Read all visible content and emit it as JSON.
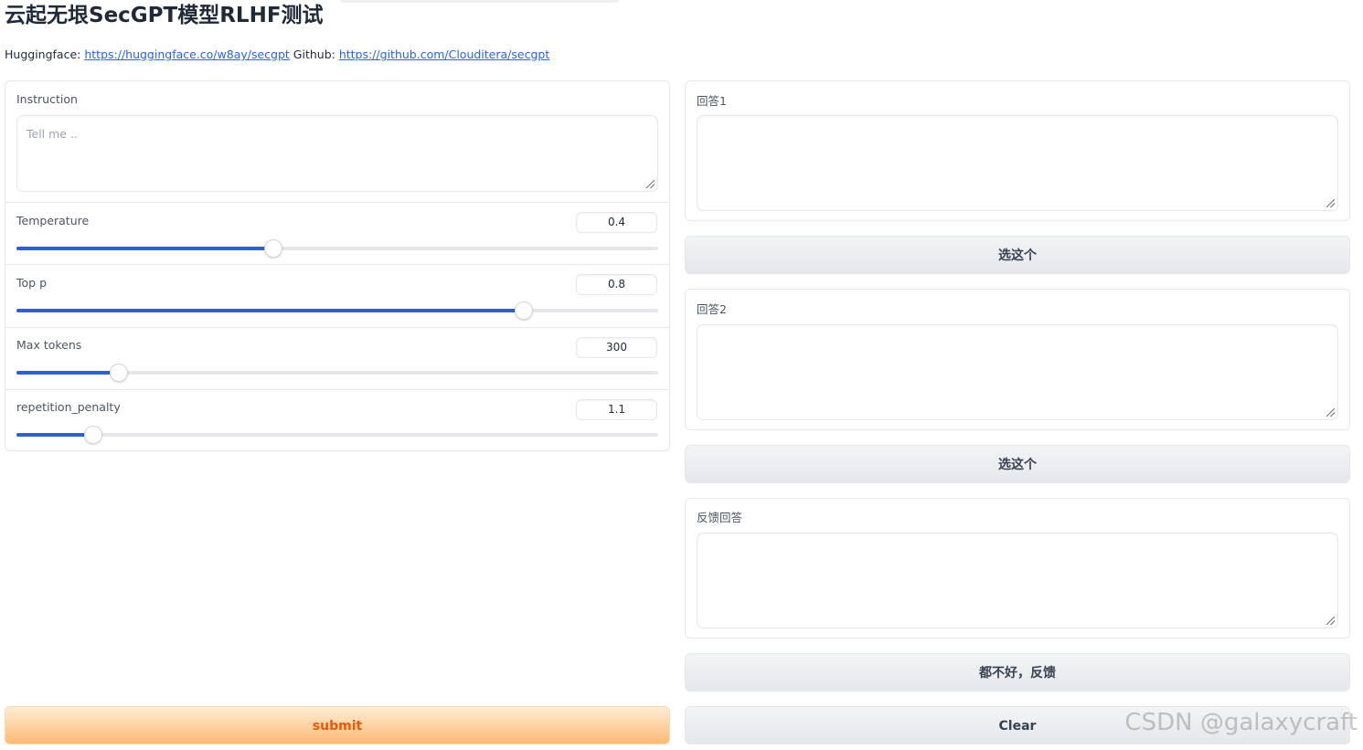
{
  "page": {
    "title": "云起无垠SecGPT模型RLHF测试",
    "links_prefix_1": "Huggingface: ",
    "link_1": "https://huggingface.co/w8ay/secgpt",
    "links_prefix_2": " Github: ",
    "link_2": "https://github.com/Clouditera/secgpt"
  },
  "settings": {
    "instruction": {
      "label": "Instruction",
      "placeholder": "Tell me ..",
      "value": ""
    },
    "temperature": {
      "label": "Temperature",
      "value": "0.4",
      "fraction": 0.4
    },
    "top_p": {
      "label": "Top p",
      "value": "0.8",
      "fraction": 0.79
    },
    "max_tokens": {
      "label": "Max tokens",
      "value": "300",
      "fraction": 0.16
    },
    "repetition_penalty": {
      "label": "repetition_penalty",
      "value": "1.1",
      "fraction": 0.12
    }
  },
  "answers": {
    "answer1_label": "回答1",
    "answer2_label": "回答2",
    "feedback_label": "反馈回答",
    "choose_label": "选这个",
    "none_good_label": "都不好，反馈"
  },
  "buttons": {
    "submit_label": "submit",
    "clear_label": "Clear"
  },
  "watermark": "CSDN @galaxycraft",
  "colors": {
    "slider_fill": "#2f5fd0",
    "primary_text": "#ea580c",
    "link": "#2563eb"
  }
}
